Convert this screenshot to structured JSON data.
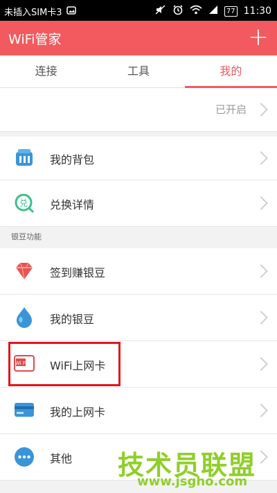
{
  "status_bar": {
    "carrier": "未插入SIM卡3",
    "battery": "77",
    "time": "11:30",
    "icons": [
      "image-icon",
      "mute-icon",
      "alarm-icon",
      "wifi-icon",
      "signal-icon",
      "battery-icon"
    ]
  },
  "app_bar": {
    "title": "WiFi管家",
    "add_label": "+"
  },
  "tabs": [
    {
      "label": "连接",
      "active": false
    },
    {
      "label": "工具",
      "active": false
    },
    {
      "label": "我的",
      "active": true
    }
  ],
  "top_row": {
    "status": "已开启"
  },
  "rows_group1": [
    {
      "label": "我的背包",
      "icon": "backpack-icon"
    },
    {
      "label": "兑换详情",
      "icon": "exchange-icon"
    }
  ],
  "section_title": "银豆功能",
  "rows_group2": [
    {
      "label": "签到赚银豆",
      "icon": "diamond-icon"
    },
    {
      "label": "我的银豆",
      "icon": "silver-bean-icon"
    },
    {
      "label": "WiFi上网卡",
      "icon": "wifi-card-icon",
      "icon_text": "Wi Fi"
    },
    {
      "label": "我的上网卡",
      "icon": "card-icon"
    },
    {
      "label": "其他",
      "icon": "more-icon"
    }
  ],
  "watermark": {
    "title": "技术员联盟",
    "url": "www.jsgho.com"
  },
  "colors": {
    "accent": "#f25a5f",
    "highlight_box": "#e4141a",
    "watermark": "#8fcf2a"
  }
}
